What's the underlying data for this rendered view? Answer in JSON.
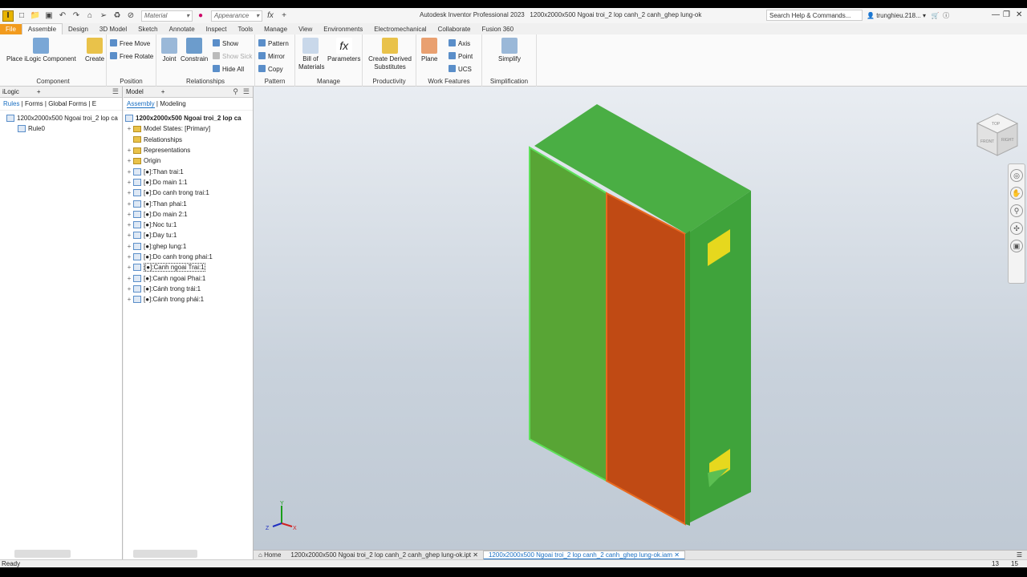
{
  "app_title": "Autodesk Inventor Professional 2023",
  "doc_title": "1200x2000x500 Ngoai troi_2 lop canh_2 canh_ghep lung-ok",
  "qat": {
    "material": "Material",
    "appearance": "Appearance"
  },
  "search": {
    "placeholder": "Search Help & Commands..."
  },
  "user": "trunghieu.218...",
  "tabs": [
    "File",
    "Assemble",
    "Design",
    "3D Model",
    "Sketch",
    "Annotate",
    "Inspect",
    "Tools",
    "Manage",
    "View",
    "Environments",
    "Electromechanical",
    "Collaborate",
    "Fusion 360"
  ],
  "ribbon": {
    "component": {
      "label": "Component",
      "place": "Place iLogic Component",
      "create": "Create"
    },
    "position": {
      "label": "Position",
      "free_move": "Free Move",
      "free_rotate": "Free Rotate"
    },
    "relationships": {
      "label": "Relationships",
      "joint": "Joint",
      "constrain": "Constrain",
      "show": "Show",
      "show_sick": "Show Sick",
      "hide_all": "Hide All"
    },
    "pattern": {
      "label": "Pattern",
      "pattern": "Pattern",
      "mirror": "Mirror",
      "copy": "Copy"
    },
    "manage": {
      "label": "Manage",
      "bom": "Bill of Materials",
      "parameters": "Parameters"
    },
    "productivity": {
      "label": "Productivity",
      "derived": "Create Derived Substitutes"
    },
    "work_features": {
      "label": "Work Features",
      "plane": "Plane",
      "axis": "Axis",
      "point": "Point",
      "ucs": "UCS"
    },
    "simplification": {
      "label": "Simplification",
      "simplify": "Simplify"
    }
  },
  "ilogic": {
    "title": "iLogic",
    "tabs": [
      "Rules",
      "Forms",
      "Global Forms",
      "E"
    ],
    "root": "1200x2000x500 Ngoai troi_2 lop ca",
    "rule": "Rule0"
  },
  "model": {
    "title": "Model",
    "subtabs": [
      "Assembly",
      "Modeling"
    ],
    "root": "1200x2000x500 Ngoai troi_2 lop ca",
    "items": [
      "Model States: [Primary]",
      "Relationships",
      "Representations",
      "Origin",
      "[●]:Than trai:1",
      "[●]:Do main 1:1",
      "[●]:Do canh trong trai:1",
      "[●]:Than phai:1",
      "[●]:Do main 2:1",
      "[●]:Noc tu:1",
      "[●]:Day tu:1",
      "[●]:ghep lung:1",
      "[●]:Do canh trong  phai:1",
      "[●]:Canh ngoai Trai:1",
      "[●]:Canh ngoai Phai:1",
      "[●]:Cánh trong trái:1",
      "[●]:Cánh trong phái:1"
    ]
  },
  "doc_tabs": {
    "home": "Home",
    "part": "1200x2000x500 Ngoai troi_2 lop canh_2 canh_ghep lung-ok.ipt",
    "assembly": "1200x2000x500 Ngoai troi_2 lop canh_2 canh_ghep lung-ok.iam"
  },
  "viewcube": {
    "top": "TOP",
    "front": "FRONT",
    "right": "RIGHT"
  },
  "axes": {
    "x": "X",
    "y": "Y",
    "z": "Z"
  },
  "status": {
    "text": "Ready",
    "n1": "13",
    "n2": "15"
  },
  "colors": {
    "body_green": "#3fa33b",
    "door_orange": "#c04a14",
    "file_tab": "#f29b1d",
    "accent": "#1a6fc2"
  }
}
